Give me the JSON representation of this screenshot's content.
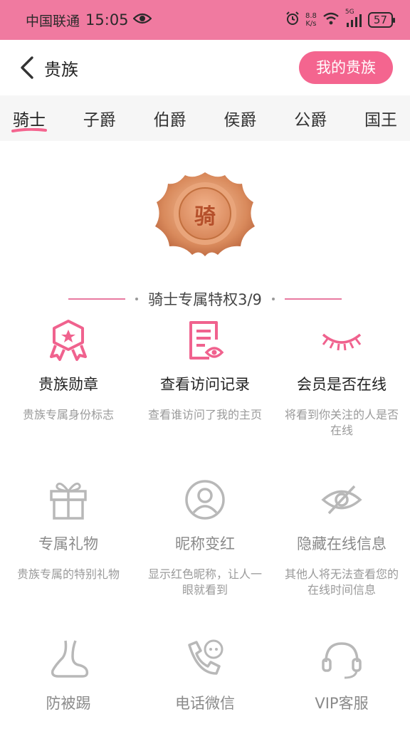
{
  "status_bar": {
    "carrier": "中国联通",
    "time": "15:05",
    "net_speed_value": "8.8",
    "net_speed_unit": "K/s",
    "network": "5G",
    "battery": "57"
  },
  "header": {
    "title": "贵族",
    "my_noble_label": "我的贵族"
  },
  "tabs": [
    "骑士",
    "子爵",
    "伯爵",
    "侯爵",
    "公爵",
    "国王"
  ],
  "active_tab": 0,
  "medal": {
    "char": "骑"
  },
  "section": {
    "title": "骑士专属特权3/9"
  },
  "privileges": [
    {
      "name": "贵族勋章",
      "desc": "贵族专属身份标志",
      "icon": "badge-icon",
      "enabled": true
    },
    {
      "name": "查看访问记录",
      "desc": "查看谁访问了我的主页",
      "icon": "visitor-record-icon",
      "enabled": true
    },
    {
      "name": "会员是否在线",
      "desc": "将看到你关注的人是否在线",
      "icon": "eye-closed-icon",
      "enabled": true
    },
    {
      "name": "专属礼物",
      "desc": "贵族专属的特别礼物",
      "icon": "gift-icon",
      "enabled": false
    },
    {
      "name": "昵称变红",
      "desc": "显示红色昵称，让人一眼就看到",
      "icon": "user-icon",
      "enabled": false
    },
    {
      "name": "隐藏在线信息",
      "desc": "其他人将无法查看您的在线时间信息",
      "icon": "eye-hidden-icon",
      "enabled": false
    },
    {
      "name": "防被踢",
      "desc": "",
      "icon": "foot-icon",
      "enabled": false
    },
    {
      "name": "电话微信",
      "desc": "",
      "icon": "phone-wechat-icon",
      "enabled": false
    },
    {
      "name": "VIP客服",
      "desc": "",
      "icon": "headset-icon",
      "enabled": false
    }
  ],
  "colors": {
    "accent": "#f4658f",
    "status_bar": "#f07aa0",
    "disabled_icon": "#b8b8b8"
  }
}
